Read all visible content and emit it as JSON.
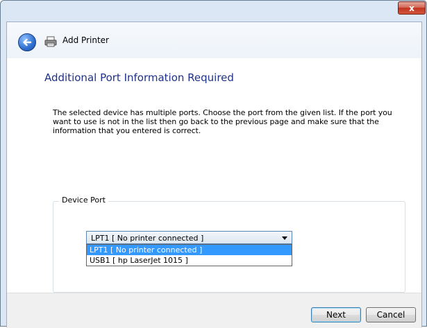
{
  "window": {
    "title": "Add Printer",
    "close_label": "x"
  },
  "page": {
    "heading": "Additional Port Information Required",
    "description": "The selected device has multiple ports.  Choose the port from the given list.  If the port you want to use is not in the list then go back to the previous page and make sure that the information that you entered is correct."
  },
  "device_port": {
    "group_label": "Device Port",
    "selected": "LPT1 [ No printer connected ]",
    "options": [
      "LPT1 [ No printer connected ]",
      "USB1 [ hp LaserJet 1015 ]"
    ]
  },
  "buttons": {
    "next": "Next",
    "cancel": "Cancel"
  },
  "icons": {
    "back": "back-arrow-icon",
    "printer": "printer-icon",
    "close": "close-icon"
  }
}
